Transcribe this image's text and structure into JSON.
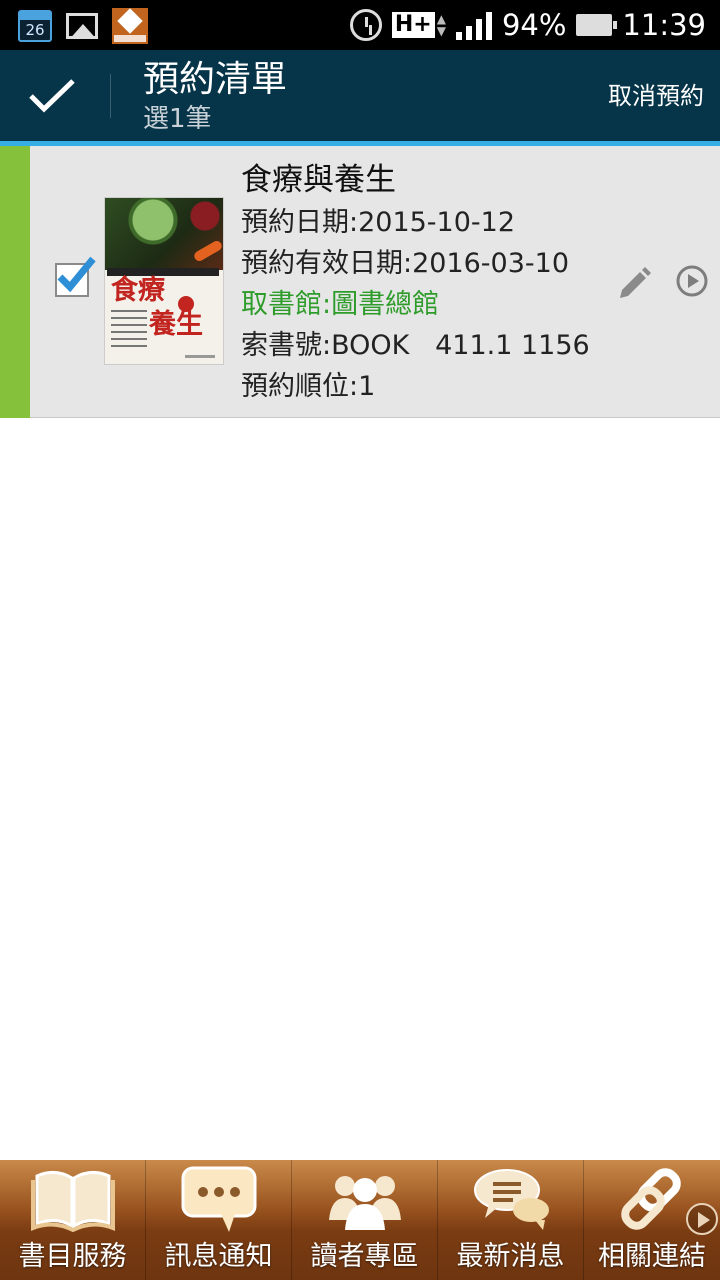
{
  "status_bar": {
    "calendar_day": "26",
    "battery": "94%",
    "time": "11:39",
    "network": "H+"
  },
  "action_bar": {
    "title": "預約清單",
    "subtitle": "選1筆",
    "cancel_label": "取消預約"
  },
  "reservations": [
    {
      "title": "食療與養生",
      "reserve_date": "預約日期:2015-10-12",
      "valid_until": "預約有效日期:2016-03-10",
      "pickup_library": "取書館:圖書總館",
      "call_number": "索書號:BOOK   411.1 1156",
      "queue_position": "預約順位:1",
      "checked": true,
      "cover_text": {
        "line1": "食療",
        "line2": "養生"
      }
    }
  ],
  "bottom_nav": {
    "items": [
      {
        "label": "書目服務",
        "icon": "book-icon"
      },
      {
        "label": "訊息通知",
        "icon": "message-icon"
      },
      {
        "label": "讀者專區",
        "icon": "people-icon"
      },
      {
        "label": "最新消息",
        "icon": "news-icon"
      },
      {
        "label": "相關連結",
        "icon": "link-icon"
      }
    ]
  },
  "colors": {
    "action_bar": "#063448",
    "accent_line": "#35aee6",
    "item_accent": "#86c13c",
    "pickup_text": "#2e9c2a",
    "nav_bar": "#9a5420"
  }
}
